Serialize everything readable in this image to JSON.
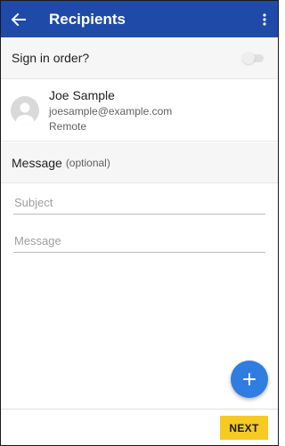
{
  "header": {
    "title": "Recipients",
    "back_icon": "arrow-left-icon",
    "menu_icon": "more-vertical-icon",
    "background": "#1f4aa8"
  },
  "sign_in_order": {
    "label": "Sign in order?",
    "enabled": false
  },
  "recipient": {
    "name": "Joe Sample",
    "email": "joesample@example.com",
    "type": "Remote",
    "avatar_icon": "person-icon"
  },
  "message_section": {
    "title": "Message",
    "optional_label": "(optional)"
  },
  "fields": {
    "subject_placeholder": "Subject",
    "subject_value": "",
    "message_placeholder": "Message",
    "message_value": ""
  },
  "fab": {
    "icon": "plus-icon",
    "color": "#2f7de1"
  },
  "footer": {
    "next_label": "NEXT",
    "next_color": "#f7c923"
  }
}
